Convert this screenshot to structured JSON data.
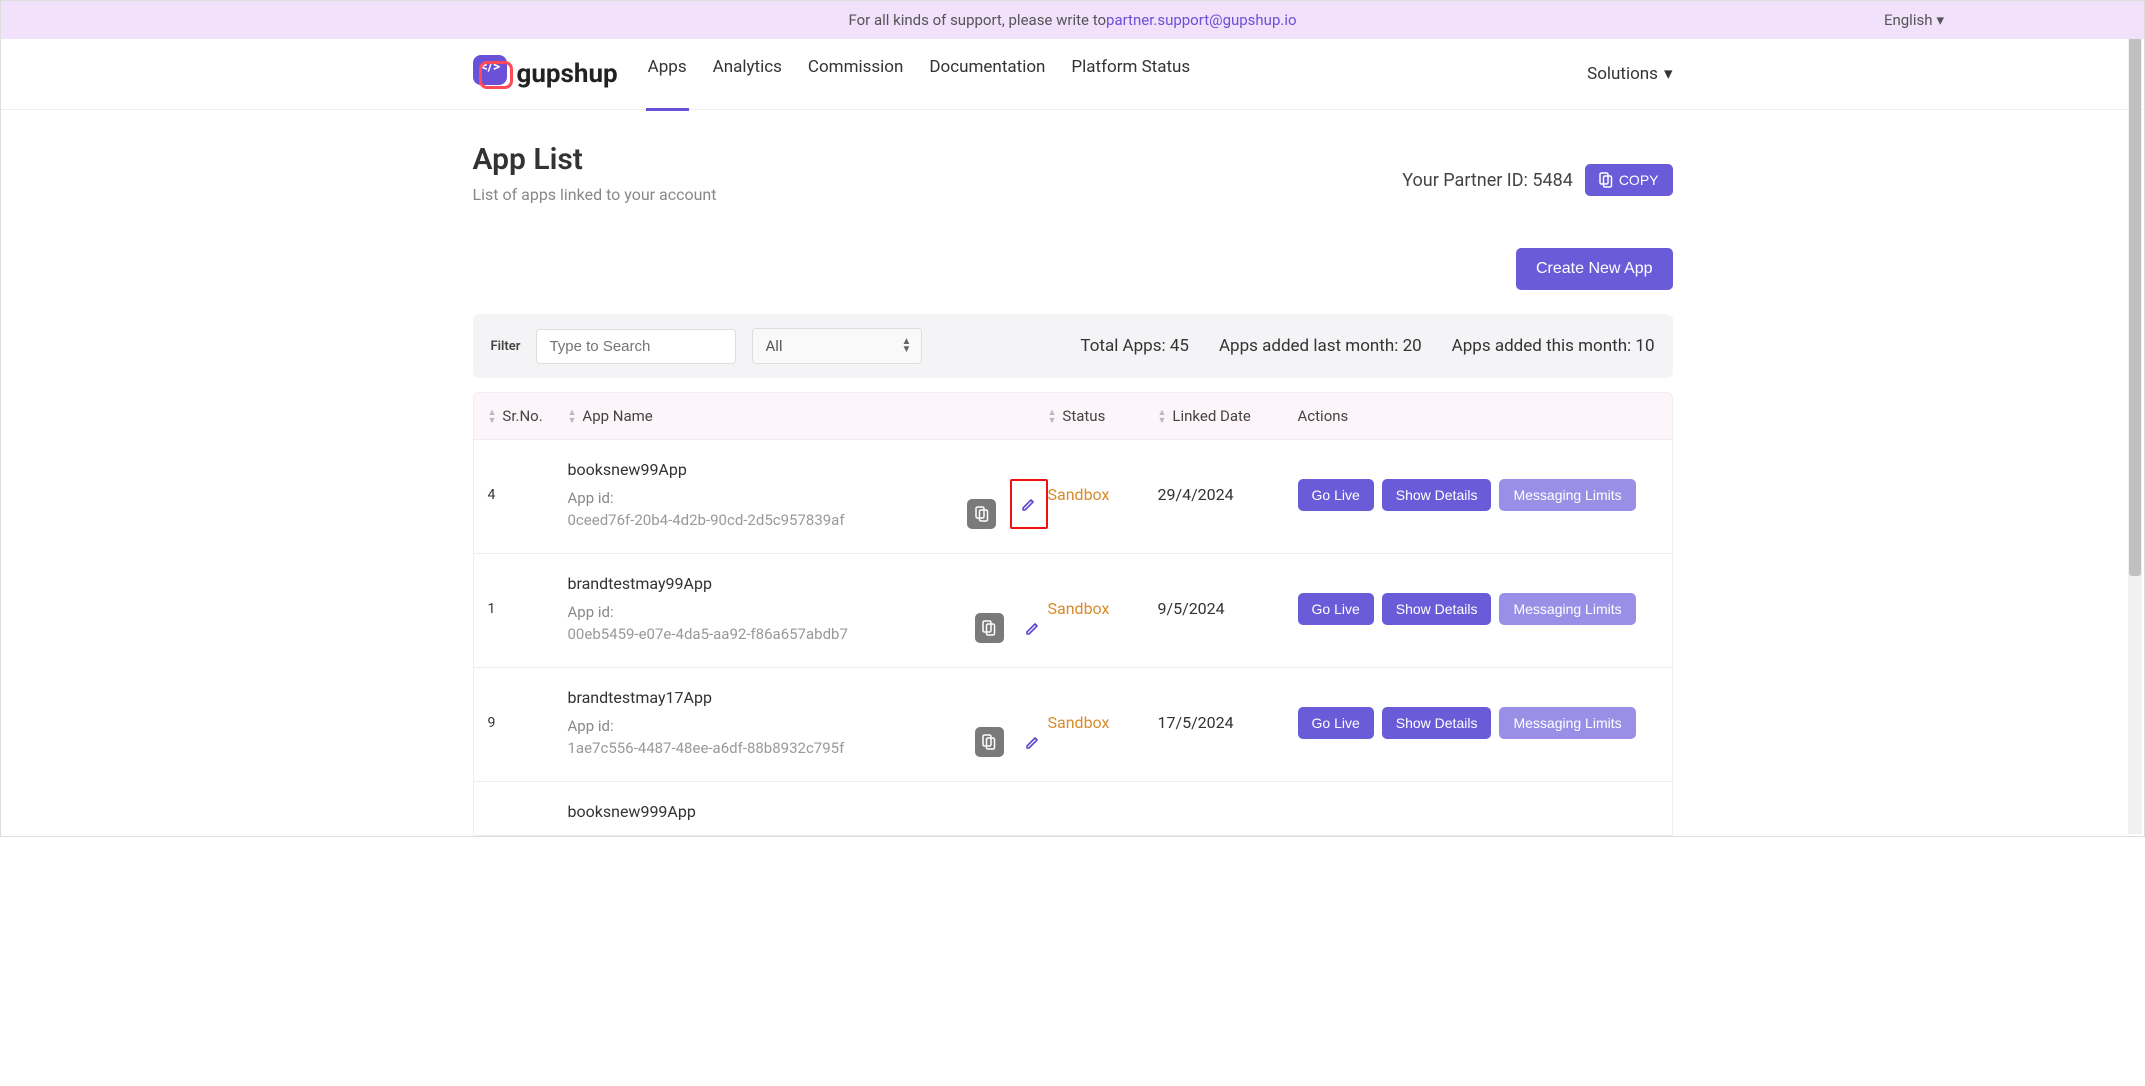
{
  "support_bar": {
    "text": "For all kinds of support, please write to ",
    "email": "partner.support@gupshup.io",
    "language": "English"
  },
  "brand": "gupshup",
  "nav": [
    {
      "label": "Apps",
      "active": true
    },
    {
      "label": "Analytics",
      "active": false
    },
    {
      "label": "Commission",
      "active": false
    },
    {
      "label": "Documentation",
      "active": false
    },
    {
      "label": "Platform Status",
      "active": false
    }
  ],
  "solutions_label": "Solutions",
  "page": {
    "title": "App List",
    "subtitle": "List of apps linked to your account"
  },
  "partner": {
    "label_prefix": "Your Partner ID: ",
    "id": "5484",
    "copy_label": "COPY"
  },
  "create_button": "Create New App",
  "filter": {
    "label": "Filter",
    "search_placeholder": "Type to Search",
    "select_value": "All"
  },
  "stats": {
    "total_label": "Total Apps: ",
    "total_value": "45",
    "last_month_label": "Apps added last month: ",
    "last_month_value": "20",
    "this_month_label": "Apps added this month: ",
    "this_month_value": "10"
  },
  "columns": {
    "srno": "Sr.No.",
    "appname": "App Name",
    "status": "Status",
    "linked": "Linked Date",
    "actions": "Actions"
  },
  "app_id_label": "App id:",
  "action_labels": {
    "go_live": "Go Live",
    "show_details": "Show Details",
    "messaging_limits": "Messaging Limits"
  },
  "rows": [
    {
      "sr": "4",
      "name": "booksnew99App",
      "app_id": "0ceed76f-20b4-4d2b-90cd-2d5c957839af",
      "status": "Sandbox",
      "date": "29/4/2024",
      "edit_highlight": true
    },
    {
      "sr": "1",
      "name": "brandtestmay99App",
      "app_id": "00eb5459-e07e-4da5-aa92-f86a657abdb7",
      "status": "Sandbox",
      "date": "9/5/2024",
      "edit_highlight": false
    },
    {
      "sr": "9",
      "name": "brandtestmay17App",
      "app_id": "1ae7c556-4487-48ee-a6df-88b8932c795f",
      "status": "Sandbox",
      "date": "17/5/2024",
      "edit_highlight": false
    },
    {
      "sr": "",
      "name": "booksnew999App",
      "app_id": "",
      "status": "",
      "date": "",
      "edit_highlight": false,
      "partial": true
    }
  ]
}
